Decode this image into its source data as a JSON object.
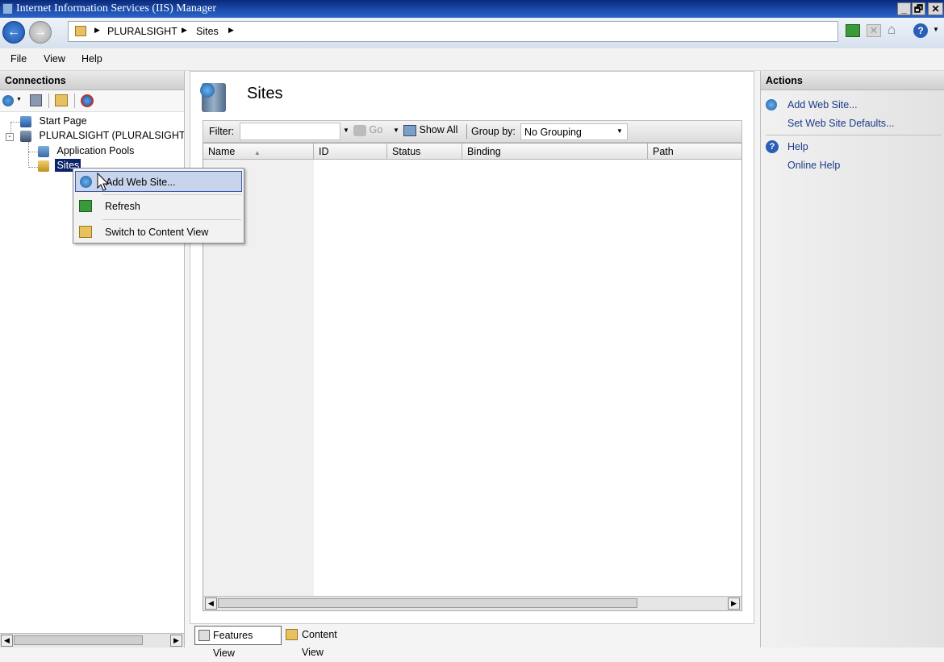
{
  "window": {
    "title": "Internet Information Services (IIS) Manager",
    "buttons": [
      "_",
      "🗗",
      "✕"
    ]
  },
  "address": {
    "crumbs": [
      "PLURALSIGHT",
      "Sites"
    ]
  },
  "menu": [
    "File",
    "View",
    "Help"
  ],
  "connections": {
    "title": "Connections",
    "tree": {
      "start_page": "Start Page",
      "server": "PLURALSIGHT (PLURALSIGHT\\sc",
      "app_pools": "Application Pools",
      "sites": "Sites"
    }
  },
  "context_menu": {
    "items": [
      "Add Web Site...",
      "Refresh",
      "Switch to Content View"
    ]
  },
  "center": {
    "title": "Sites",
    "filter_label": "Filter:",
    "filter_value": "",
    "go_label": "Go",
    "show_all_label": "Show All",
    "group_by_label": "Group by:",
    "group_by_value": "No Grouping",
    "columns": [
      "Name",
      "ID",
      "Status",
      "Binding",
      "Path"
    ]
  },
  "views": {
    "features": "Features View",
    "content": "Content View"
  },
  "actions": {
    "title": "Actions",
    "items": [
      "Add Web Site...",
      "Set Web Site Defaults..."
    ],
    "help": [
      "Help",
      "Online Help"
    ]
  },
  "colors": {
    "titlebar": "#1d4fb0",
    "selection": "#0a246a",
    "link": "#1a3a8a"
  }
}
